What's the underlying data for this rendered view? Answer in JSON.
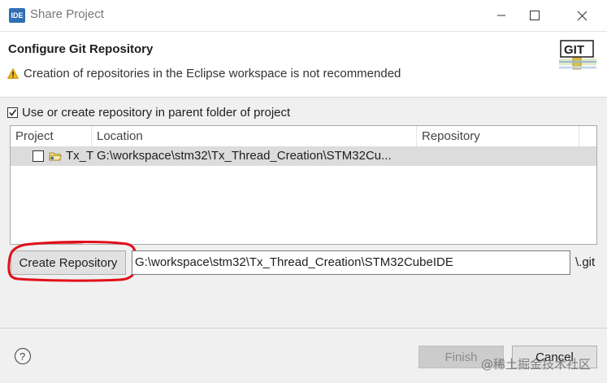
{
  "window": {
    "app_icon_text": "IDE",
    "title": "Share Project"
  },
  "header": {
    "title": "Configure Git Repository",
    "warning": "Creation of repositories in the Eclipse workspace is not recommended",
    "logo_text": "GIT"
  },
  "options": {
    "use_parent_label": "Use or create repository in parent folder of project",
    "use_parent_checked": true
  },
  "table": {
    "columns": [
      "Project",
      "Location",
      "Repository"
    ],
    "rows": [
      {
        "project": "Tx_T",
        "location": "G:\\workspace\\stm32\\Tx_Thread_Creation\\STM32Cu...",
        "repository": "",
        "checked": false
      }
    ]
  },
  "create": {
    "button_label": "Create Repository",
    "path_value": "G:\\workspace\\stm32\\Tx_Thread_Creation\\STM32CubeIDE",
    "suffix": "\\.git"
  },
  "footer": {
    "finish_label": "Finish",
    "cancel_label": "Cancel"
  },
  "watermark": "@稀土掘金技术社区",
  "colors": {
    "annotation_red": "#e0101a",
    "app_icon_blue": "#2f6fb5"
  }
}
